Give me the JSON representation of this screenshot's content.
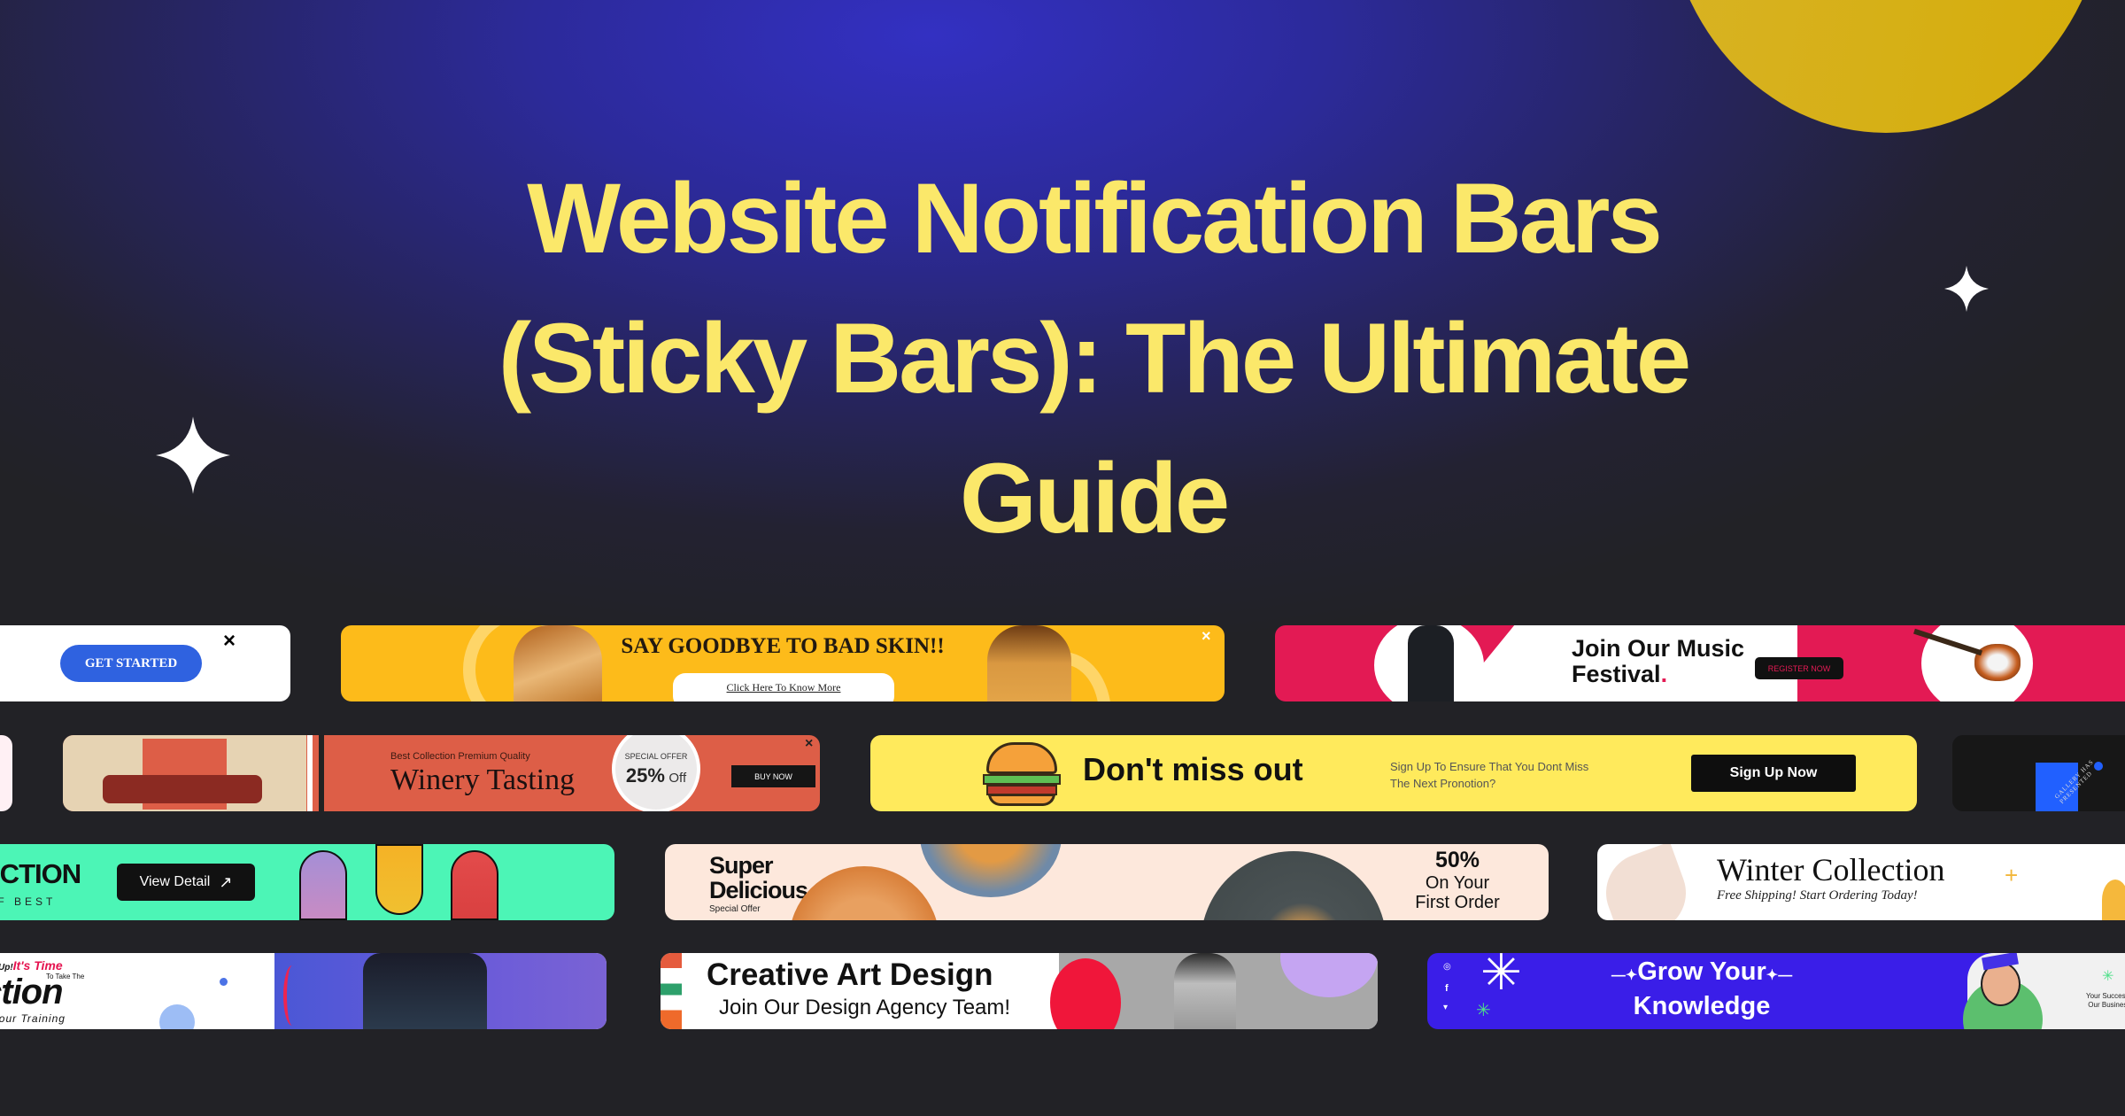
{
  "hero": {
    "title_line1": "Website Notification Bars",
    "title_line2": "(Sticky Bars): The Ultimate",
    "title_line3": "Guide",
    "colors": {
      "title": "#fbe86a",
      "accent_circle": "#d5ad0a",
      "background_top": "#3330c2",
      "background_bottom": "#232224"
    }
  },
  "bars": {
    "get_started": {
      "button": "GET STARTED",
      "close": "×",
      "colors": {
        "bg": "#ffffff",
        "button": "#2f62e0"
      }
    },
    "skin": {
      "headline": "SAY GOODBYE TO BAD SKIN!!",
      "link": "Click Here To Know More",
      "close": "×",
      "colors": {
        "bg": "#fdbb1a"
      }
    },
    "music": {
      "headline_line1": "Join Our Music",
      "headline_line2": "Festival",
      "dot": ".",
      "button": "REGISTER NOW",
      "colors": {
        "bg": "#e31a54"
      }
    },
    "winery": {
      "kicker": "Best Collection Premium Quality",
      "headline": "Winery Tasting",
      "badge_top": "SPECIAL OFFER",
      "badge_value": "25%",
      "badge_suffix": "Off",
      "button": "BUY NOW",
      "close": "×",
      "colors": {
        "bg": "#dd5e47",
        "left_bg": "#e6d3b3"
      }
    },
    "burger": {
      "headline": "Don't miss out",
      "subtext_line1": "Sign Up To Ensure That You Dont Miss",
      "subtext_line2": "The Next Pronotion?",
      "button": "Sign Up Now",
      "colors": {
        "bg": "#ffea5c"
      }
    },
    "gallery": {
      "curved_text": "GALLERY HAS PRESENTED",
      "colors": {
        "bg": "#171717",
        "accent": "#2160ff"
      }
    },
    "collection": {
      "headline": "ECTION",
      "subline": "FF BEST",
      "button": "View Detail",
      "button_icon": "↗",
      "colors": {
        "bg": "#4cf5b6"
      }
    },
    "food": {
      "headline_line1": "Super",
      "headline_line2": "Delicious",
      "kicker": "Special Offer",
      "offer_value": "50%",
      "offer_line1": "On Your",
      "offer_line2": "First Order",
      "colors": {
        "bg": "#fde8dc"
      }
    },
    "winter": {
      "headline": "Winter Collection",
      "subtext": "Free Shipping! Start Ordering Today!",
      "colors": {
        "bg": "#ffffff"
      }
    },
    "fitness": {
      "kicker_black": "Up!",
      "kicker_pink": "It's Time",
      "small": "To Take The",
      "headline": "ction",
      "subline": "t Your Training",
      "colors": {
        "bg": "#ffffff",
        "photo_bg": "#5a55d6"
      }
    },
    "creative": {
      "headline": "Creative Art Design",
      "subtext": "Join Our Design Agency Team!",
      "colors": {
        "bg": "#ffffff"
      }
    },
    "knowledge": {
      "headline_line1": "Grow Your",
      "headline_line2": "Knowledge",
      "side_line1": "Your Success",
      "side_line2": "Our Busines",
      "social": [
        "instagram",
        "facebook",
        "twitter"
      ],
      "colors": {
        "bg": "#3a1ee8"
      }
    }
  }
}
